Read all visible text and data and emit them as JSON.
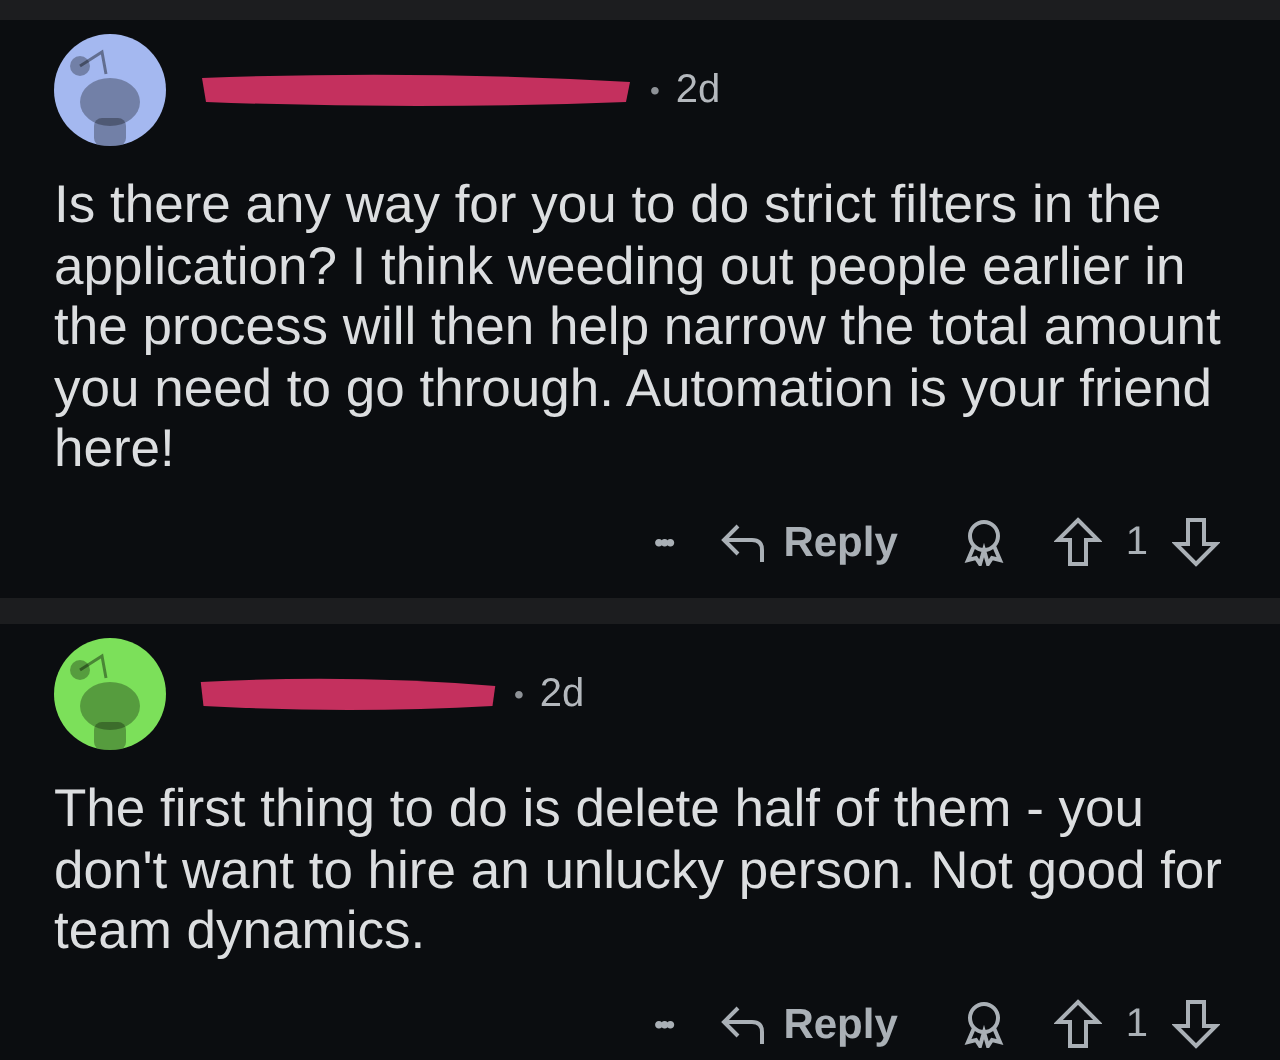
{
  "comments": [
    {
      "color": "#a4b8f0",
      "separator": "•",
      "time": "2d",
      "body": "Is there any way for you to do strict filters in the application? I think weeding out people earlier in the process will then help narrow the total amount you need to go through. Automation is your friend here!",
      "more": "•••",
      "reply": "Reply",
      "votes": "1"
    },
    {
      "color": "#7ce05a",
      "separator": "•",
      "time": "2d",
      "body": "The first thing to do is delete half of them - you don't want to hire an unlucky person. Not good for team dynamics.",
      "more": "•••",
      "reply": "Reply",
      "votes": "1"
    }
  ]
}
